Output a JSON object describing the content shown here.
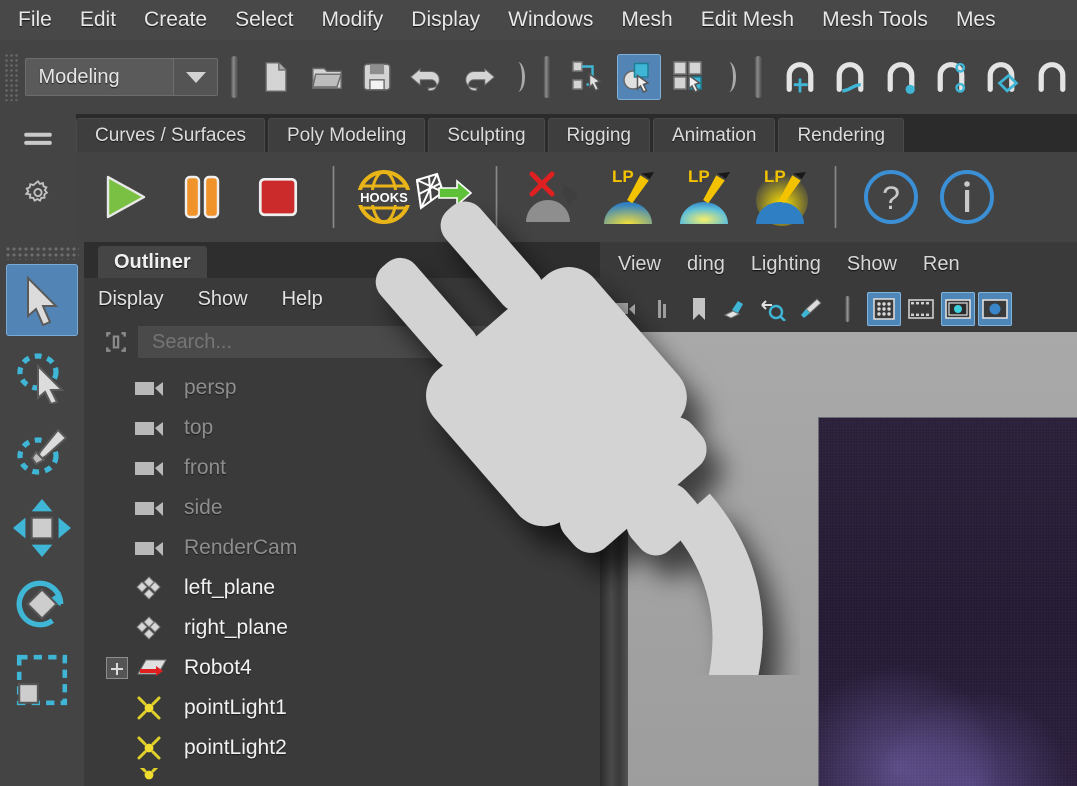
{
  "menubar": {
    "items": [
      {
        "label": "File"
      },
      {
        "label": "Edit"
      },
      {
        "label": "Create"
      },
      {
        "label": "Select"
      },
      {
        "label": "Modify"
      },
      {
        "label": "Display"
      },
      {
        "label": "Windows"
      },
      {
        "label": "Mesh"
      },
      {
        "label": "Edit Mesh"
      },
      {
        "label": "Mesh Tools"
      },
      {
        "label": "Mes"
      }
    ]
  },
  "toolbar": {
    "menuset": "Modeling",
    "icons": [
      {
        "name": "new-scene-icon"
      },
      {
        "name": "open-scene-icon"
      },
      {
        "name": "save-scene-icon"
      },
      {
        "name": "undo-icon"
      },
      {
        "name": "redo-icon"
      },
      {
        "name": "select-by-hierarchy-icon"
      },
      {
        "name": "select-by-object-icon"
      },
      {
        "name": "select-by-component-icon"
      },
      {
        "name": "snap-to-grid-icon"
      },
      {
        "name": "snap-to-curve-icon"
      },
      {
        "name": "snap-to-point-icon"
      },
      {
        "name": "snap-to-projected-center-icon"
      },
      {
        "name": "snap-to-plane-icon"
      },
      {
        "name": "snap-to-view-plane-icon"
      }
    ],
    "active_icon": "select-by-object-icon",
    "accent_blue": "#5285b5"
  },
  "shelf": {
    "tabs": [
      {
        "label": "Curves / Surfaces"
      },
      {
        "label": "Poly Modeling"
      },
      {
        "label": "Sculpting"
      },
      {
        "label": "Rigging"
      },
      {
        "label": "Animation"
      },
      {
        "label": "Rendering"
      }
    ],
    "side_icons": [
      {
        "name": "shelf-menu-icon"
      },
      {
        "name": "shelf-settings-gear-icon"
      }
    ],
    "buttons": [
      {
        "name": "play-button",
        "color": "#79c143"
      },
      {
        "name": "pause-button",
        "color": "#f0932b"
      },
      {
        "name": "stop-button",
        "color": "#cc2b2b"
      },
      {
        "name": "hooks-export-button",
        "label": "HOOKS",
        "color": "#e8b417"
      },
      {
        "name": "delete-light-preset-button",
        "color": "#e02020"
      },
      {
        "name": "light-preset-grey-button"
      },
      {
        "name": "light-preset-lp1-button",
        "label": "LP"
      },
      {
        "name": "light-preset-lp2-button",
        "label": "LP"
      },
      {
        "name": "light-preset-lp3-button",
        "label": "LP"
      },
      {
        "name": "help-button"
      },
      {
        "name": "info-button"
      }
    ]
  },
  "toolbox": {
    "tools": [
      {
        "name": "select-tool",
        "active": true
      },
      {
        "name": "lasso-select-tool",
        "active": false
      },
      {
        "name": "paint-select-tool",
        "active": false
      },
      {
        "name": "move-tool",
        "active": false
      },
      {
        "name": "rotate-tool",
        "active": false
      },
      {
        "name": "scale-tool",
        "active": false
      }
    ]
  },
  "outliner": {
    "title": "Outliner",
    "menus": [
      {
        "label": "Display"
      },
      {
        "label": "Show"
      },
      {
        "label": "Help"
      }
    ],
    "search_placeholder": "Search...",
    "search_value": "",
    "items": [
      {
        "label": "persp",
        "icon": "camera-icon",
        "dim": true,
        "expandable": false
      },
      {
        "label": "top",
        "icon": "camera-icon",
        "dim": true,
        "expandable": false
      },
      {
        "label": "front",
        "icon": "camera-icon",
        "dim": true,
        "expandable": false
      },
      {
        "label": "side",
        "icon": "camera-icon",
        "dim": true,
        "expandable": false
      },
      {
        "label": "RenderCam",
        "icon": "camera-icon",
        "dim": true,
        "expandable": false
      },
      {
        "label": "left_plane",
        "icon": "transform-icon",
        "dim": false,
        "expandable": false
      },
      {
        "label": "right_plane",
        "icon": "transform-icon",
        "dim": false,
        "expandable": false
      },
      {
        "label": "Robot4",
        "icon": "mesh-group-icon",
        "dim": false,
        "expandable": true
      },
      {
        "label": "pointLight1",
        "icon": "point-light-icon",
        "dim": false,
        "expandable": false
      },
      {
        "label": "pointLight2",
        "icon": "point-light-icon",
        "dim": false,
        "expandable": false
      }
    ]
  },
  "viewport": {
    "menus": [
      {
        "label": "View"
      },
      {
        "label": "ding"
      },
      {
        "label": "Lighting"
      },
      {
        "label": "Show"
      },
      {
        "label": "Ren"
      }
    ],
    "tool_icons": [
      {
        "name": "bookmark-icon",
        "active": false
      },
      {
        "name": "image-plane-icon",
        "active": false
      },
      {
        "name": "zoom-region-icon",
        "active": false
      },
      {
        "name": "paint-effects-icon",
        "active": false
      },
      {
        "name": "grid-toggle-icon",
        "active": true
      },
      {
        "name": "film-gate-icon",
        "active": false
      },
      {
        "name": "resolution-gate-icon",
        "active": true
      },
      {
        "name": "gate-mask-icon",
        "active": true
      }
    ],
    "render_region_color": "#281d39"
  },
  "cursor": {
    "name": "plug-cursor",
    "color": "#d2d2d2"
  }
}
